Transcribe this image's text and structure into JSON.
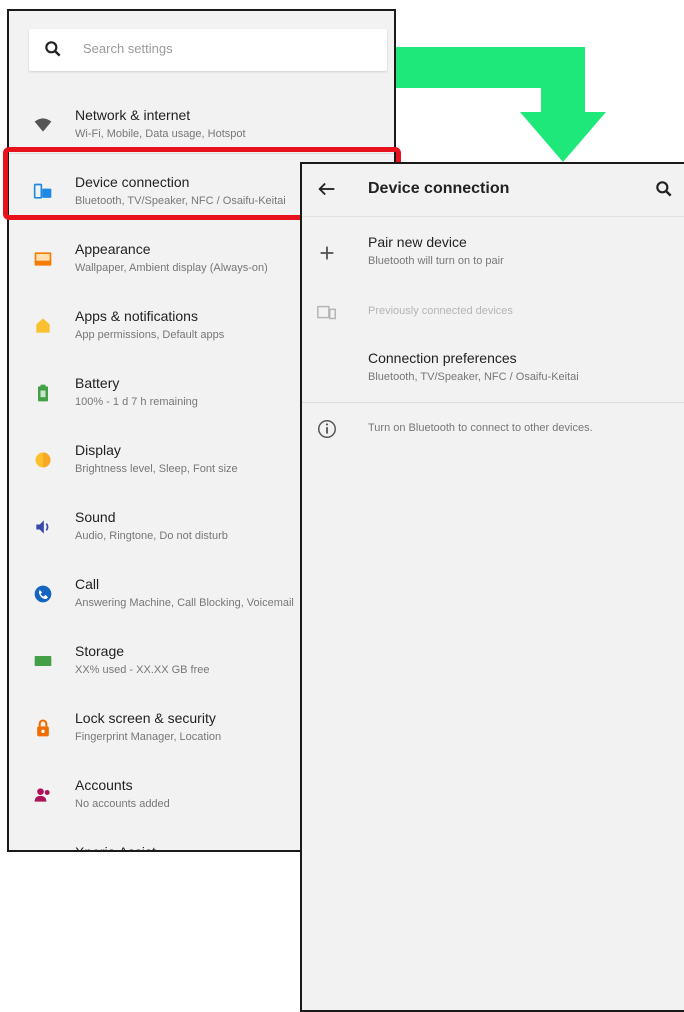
{
  "settings": {
    "search_placeholder": "Search settings",
    "items": [
      {
        "title": "Network & internet",
        "subtitle": "Wi-Fi, Mobile, Data usage, Hotspot",
        "icon": "wifi-icon",
        "color": "#555555"
      },
      {
        "title": "Device connection",
        "subtitle": "Bluetooth, TV/Speaker, NFC / Osaifu-Keitai",
        "icon": "device-connection-icon",
        "color": "#1e88e5"
      },
      {
        "title": "Appearance",
        "subtitle": "Wallpaper, Ambient display (Always-on)",
        "icon": "appearance-icon",
        "color": "#f57c00"
      },
      {
        "title": "Apps & notifications",
        "subtitle": "App permissions, Default apps",
        "icon": "apps-icon",
        "color": "#fbc02d"
      },
      {
        "title": "Battery",
        "subtitle": "100% - 1 d 7 h remaining",
        "icon": "battery-icon",
        "color": "#43a047"
      },
      {
        "title": "Display",
        "subtitle": "Brightness level, Sleep, Font size",
        "icon": "display-icon",
        "color": "#fbc02d"
      },
      {
        "title": "Sound",
        "subtitle": "Audio, Ringtone, Do not disturb",
        "icon": "sound-icon",
        "color": "#3949ab"
      },
      {
        "title": "Call",
        "subtitle": "Answering Machine, Call Blocking, Voicemail",
        "icon": "call-icon",
        "color": "#1565c0"
      },
      {
        "title": "Storage",
        "subtitle": "XX% used - XX.XX GB free",
        "icon": "storage-icon",
        "color": "#43a047"
      },
      {
        "title": "Lock screen & security",
        "subtitle": "Fingerprint Manager, Location",
        "icon": "lock-icon",
        "color": "#ef6c00"
      },
      {
        "title": "Accounts",
        "subtitle": "No accounts added",
        "icon": "accounts-icon",
        "color": "#ad1457"
      },
      {
        "title": "Xperia Assist",
        "subtitle": "",
        "icon": "assist-icon",
        "color": "#555555"
      }
    ]
  },
  "device_connection": {
    "title": "Device connection",
    "pair": {
      "title": "Pair new device",
      "subtitle": "Bluetooth will turn on to pair"
    },
    "previous": {
      "title": "Previously connected devices"
    },
    "preferences": {
      "title": "Connection preferences",
      "subtitle": "Bluetooth, TV/Speaker, NFC / Osaifu-Keitai"
    },
    "info": "Turn on Bluetooth to connect to other devices."
  },
  "colors": {
    "highlight": "#e8121c",
    "arrow": "#1ee87a"
  }
}
